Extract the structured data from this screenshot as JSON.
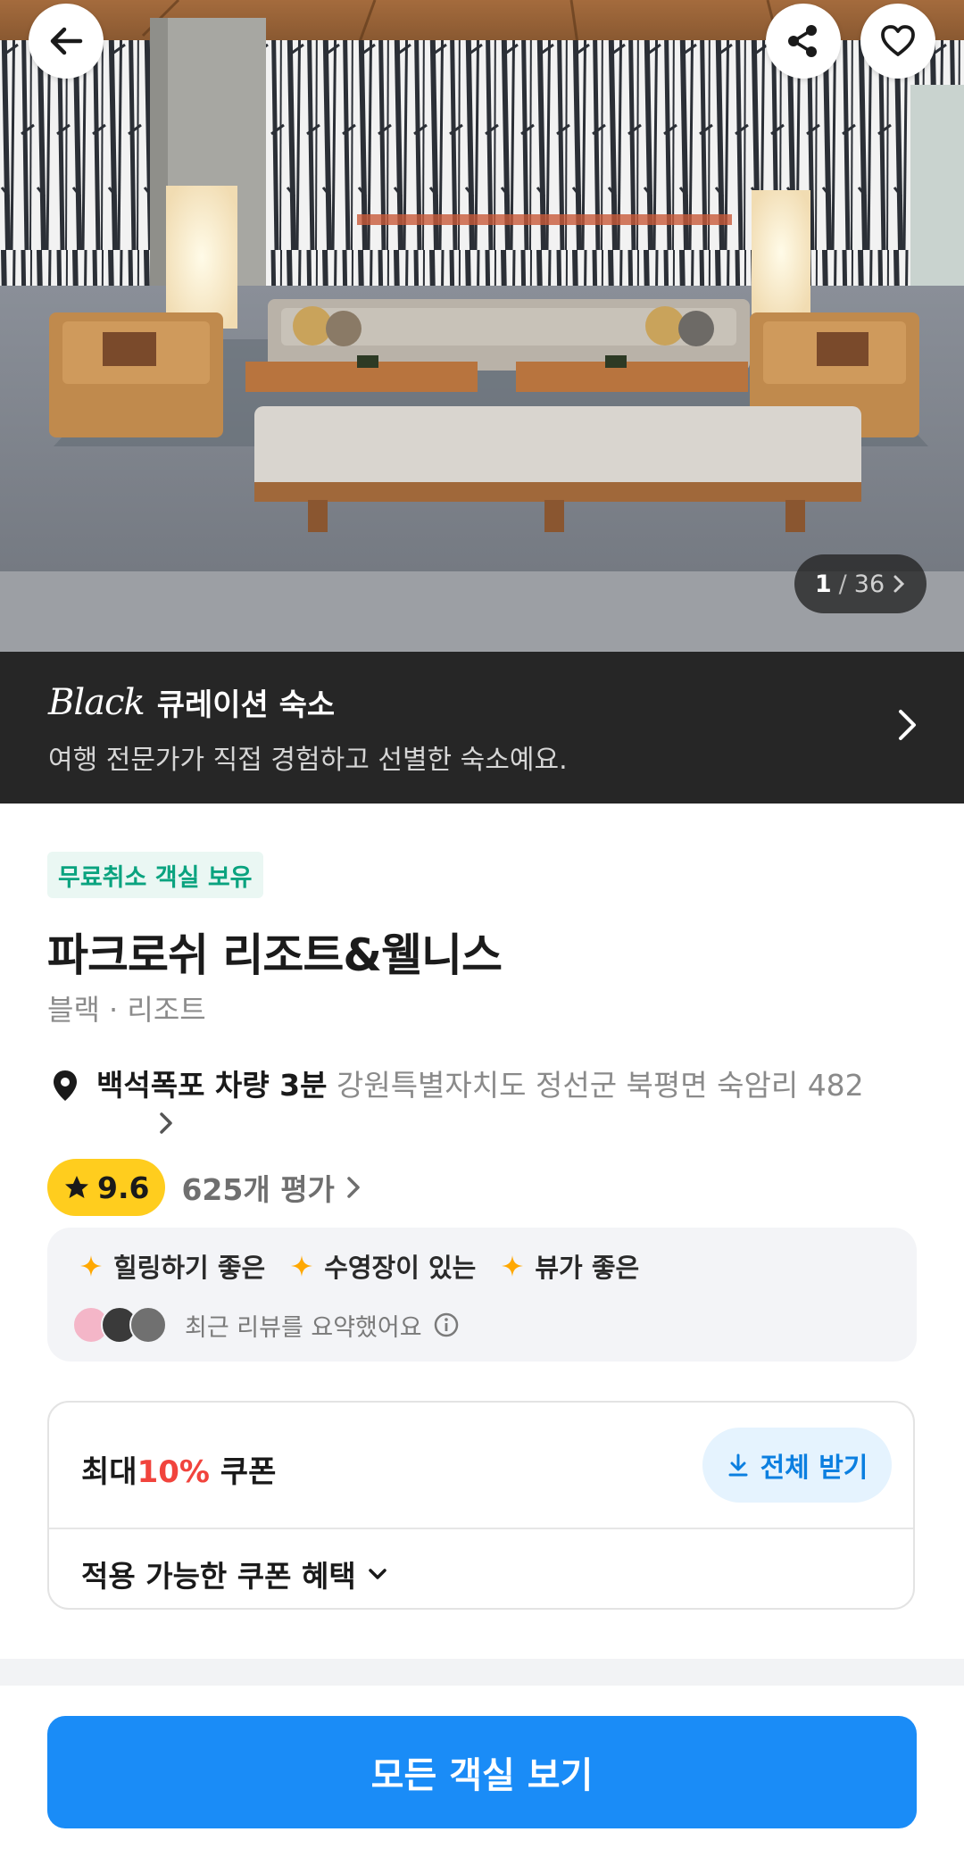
{
  "gallery": {
    "current": "1",
    "separator": "/",
    "total": "36"
  },
  "header": {
    "back_icon": "arrow-left-icon",
    "share_icon": "share-icon",
    "favorite_icon": "heart-icon"
  },
  "banner": {
    "brand": "Black",
    "title": "큐레이션 숙소",
    "description": "여행 전문가가 직접 경험하고 선별한 숙소예요."
  },
  "property": {
    "badge": "무료취소 객실 보유",
    "name": "파크로쉬 리조트&웰니스",
    "category": "블랙 · 리조트",
    "nearby": "백석폭포 차량 3분",
    "address": "강원특별자치도 정선군 북평면 숙암리 482"
  },
  "rating": {
    "score": "9.6",
    "review_count": "625개 평가"
  },
  "summary": {
    "tags": [
      "힐링하기 좋은",
      "수영장이 있는",
      "뷰가 좋은"
    ],
    "note": "최근 리뷰를 요약했어요"
  },
  "coupon": {
    "prefix": "최대",
    "percent": "10%",
    "suffix": "쿠폰",
    "get_all": "전체 받기",
    "benefits": "적용 가능한 쿠폰 혜택"
  },
  "cta": {
    "label": "모든 객실 보기"
  },
  "colors": {
    "accent": "#1a8cf7",
    "rating": "#ffcd1e",
    "badge_text": "#0aa37f",
    "coupon_percent": "#f1443d",
    "banner_bg": "#262626"
  }
}
